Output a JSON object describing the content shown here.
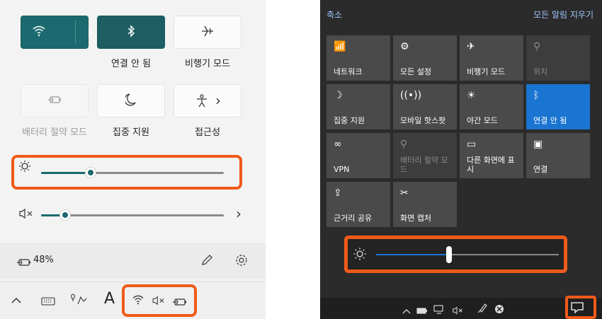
{
  "left": {
    "tiles": {
      "wifi": {
        "icon": "wifi-icon",
        "chevron": "›"
      },
      "bluetooth": {
        "icon": "bluetooth-icon",
        "label": "연결 안 됨"
      },
      "airplane": {
        "icon": "airplane-icon",
        "label": "비행기 모드"
      },
      "battery_saver": {
        "icon": "battery-saver-icon",
        "label": "배터리 절약 모드"
      },
      "focus": {
        "icon": "moon-icon",
        "label": "집중 지원"
      },
      "accessibility": {
        "icon": "accessibility-icon",
        "chevron": "›",
        "label": "접근성"
      }
    },
    "brightness": {
      "icon": "brightness-icon",
      "level": 0.27
    },
    "volume": {
      "icon": "volume-mute-icon",
      "level": 0.13,
      "chevron": "›"
    },
    "battery": {
      "text": "48%"
    },
    "taskbar": {
      "input_letter": "A"
    }
  },
  "right": {
    "collapse": "축소",
    "clear_all": "모든 알림 지우기",
    "tiles": [
      {
        "label": "네트워크",
        "icon": "network-icon",
        "state": "normal"
      },
      {
        "label": "모든 설정",
        "icon": "gear-icon",
        "state": "normal"
      },
      {
        "label": "비행기 모드",
        "icon": "airplane-icon",
        "state": "normal"
      },
      {
        "label": "위치",
        "icon": "location-icon",
        "state": "dim"
      },
      {
        "label": "집중 지원",
        "icon": "moon-icon",
        "state": "normal"
      },
      {
        "label": "모바일 핫스팟",
        "icon": "hotspot-icon",
        "state": "normal"
      },
      {
        "label": "야간 모드",
        "icon": "night-light-icon",
        "state": "normal"
      },
      {
        "label": "연결 안 됨",
        "icon": "bluetooth-icon",
        "state": "blue"
      },
      {
        "label": "VPN",
        "icon": "vpn-icon",
        "state": "normal"
      },
      {
        "label": "배터리 절약 모드",
        "icon": "battery-saver-icon",
        "state": "dim"
      },
      {
        "label": "다른 화면에 표시",
        "icon": "project-icon",
        "state": "normal"
      },
      {
        "label": "연결",
        "icon": "connect-icon",
        "state": "normal"
      },
      {
        "label": "근거리 공유",
        "icon": "share-icon",
        "state": "normal"
      },
      {
        "label": "화면 캡처",
        "icon": "screen-capture-icon",
        "state": "normal"
      }
    ],
    "brightness": {
      "icon": "brightness-icon",
      "level": 0.4
    }
  }
}
